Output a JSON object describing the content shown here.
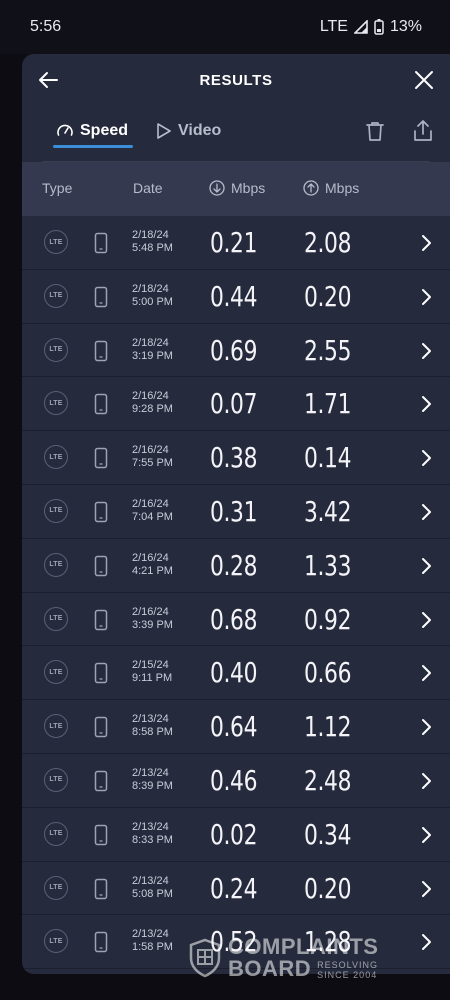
{
  "status_bar": {
    "time": "5:56",
    "network": "LTE",
    "battery": "13%"
  },
  "header": {
    "title": "RESULTS",
    "back_icon": "back-arrow-icon",
    "close_icon": "close-icon"
  },
  "tabs": [
    {
      "label": "Speed",
      "icon": "speedometer-icon",
      "active": true
    },
    {
      "label": "Video",
      "icon": "play-icon",
      "active": false
    }
  ],
  "toolbar": {
    "delete_icon": "trash-icon",
    "share_icon": "share-icon"
  },
  "columns": {
    "type": "Type",
    "date": "Date",
    "download": "Mbps",
    "upload": "Mbps"
  },
  "rows": [
    {
      "type": "LTE",
      "date": "2/18/24",
      "time": "5:48 PM",
      "download": "0.21",
      "upload": "2.08"
    },
    {
      "type": "LTE",
      "date": "2/18/24",
      "time": "5:00 PM",
      "download": "0.44",
      "upload": "0.20"
    },
    {
      "type": "LTE",
      "date": "2/18/24",
      "time": "3:19 PM",
      "download": "0.69",
      "upload": "2.55"
    },
    {
      "type": "LTE",
      "date": "2/16/24",
      "time": "9:28 PM",
      "download": "0.07",
      "upload": "1.71"
    },
    {
      "type": "LTE",
      "date": "2/16/24",
      "time": "7:55 PM",
      "download": "0.38",
      "upload": "0.14"
    },
    {
      "type": "LTE",
      "date": "2/16/24",
      "time": "7:04 PM",
      "download": "0.31",
      "upload": "3.42"
    },
    {
      "type": "LTE",
      "date": "2/16/24",
      "time": "4:21 PM",
      "download": "0.28",
      "upload": "1.33"
    },
    {
      "type": "LTE",
      "date": "2/16/24",
      "time": "3:39 PM",
      "download": "0.68",
      "upload": "0.92"
    },
    {
      "type": "LTE",
      "date": "2/15/24",
      "time": "9:11 PM",
      "download": "0.40",
      "upload": "0.66"
    },
    {
      "type": "LTE",
      "date": "2/13/24",
      "time": "8:58 PM",
      "download": "0.64",
      "upload": "1.12"
    },
    {
      "type": "LTE",
      "date": "2/13/24",
      "time": "8:39 PM",
      "download": "0.46",
      "upload": "2.48"
    },
    {
      "type": "LTE",
      "date": "2/13/24",
      "time": "8:33 PM",
      "download": "0.02",
      "upload": "0.34"
    },
    {
      "type": "LTE",
      "date": "2/13/24",
      "time": "5:08 PM",
      "download": "0.24",
      "upload": "0.20"
    },
    {
      "type": "LTE",
      "date": "2/13/24",
      "time": "1:58 PM",
      "download": "0.52",
      "upload": "1.28"
    }
  ],
  "watermark": {
    "line1": "COMPLAINTS",
    "line2": "BOARD",
    "tagline1": "RESOLVING",
    "tagline2": "SINCE 2004"
  },
  "colors": {
    "accent": "#3a8fd8",
    "sheet_bg": "#262a3d",
    "header_row_bg": "#343950"
  }
}
